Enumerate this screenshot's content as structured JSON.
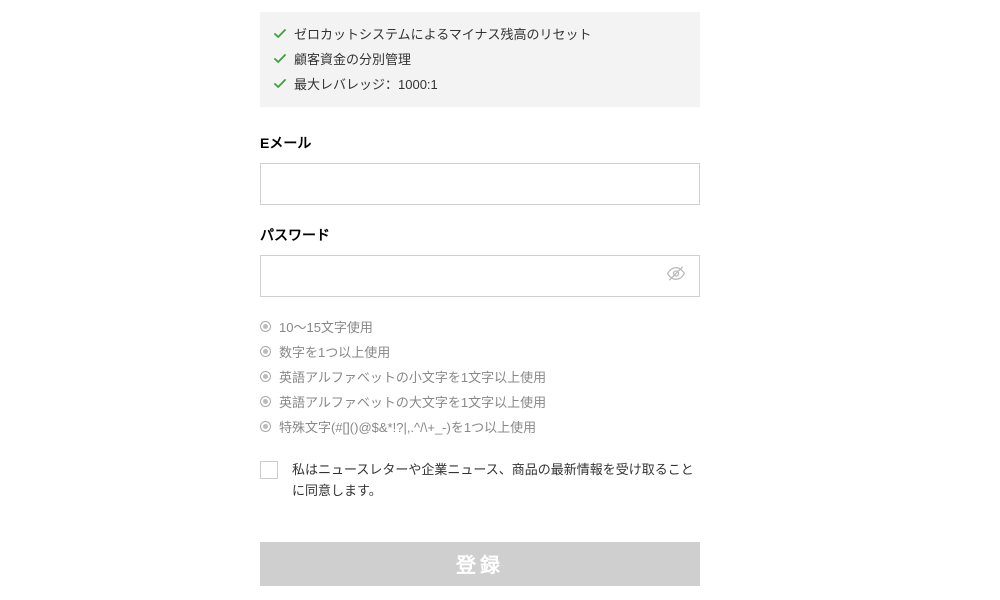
{
  "features": {
    "items": [
      "ゼロカットシステムによるマイナス残高のリセット",
      "顧客資金の分別管理",
      "最大レバレッジ：1000:1"
    ]
  },
  "form": {
    "email": {
      "label": "Eメール",
      "value": ""
    },
    "password": {
      "label": "パスワード",
      "value": ""
    },
    "requirements": [
      "10～15文字使用",
      "数字を1つ以上使用",
      "英語アルファベットの小文字を1文字以上使用",
      "英語アルファベットの大文字を1文字以上使用",
      "特殊文字(#[]()@$&*!?|,.^/\\+_-)を1つ以上使用"
    ],
    "consent": {
      "text": "私はニュースレターや企業ニュース、商品の最新情報を受け取ることに同意します。",
      "checked": false
    },
    "submit_label": "登録"
  }
}
